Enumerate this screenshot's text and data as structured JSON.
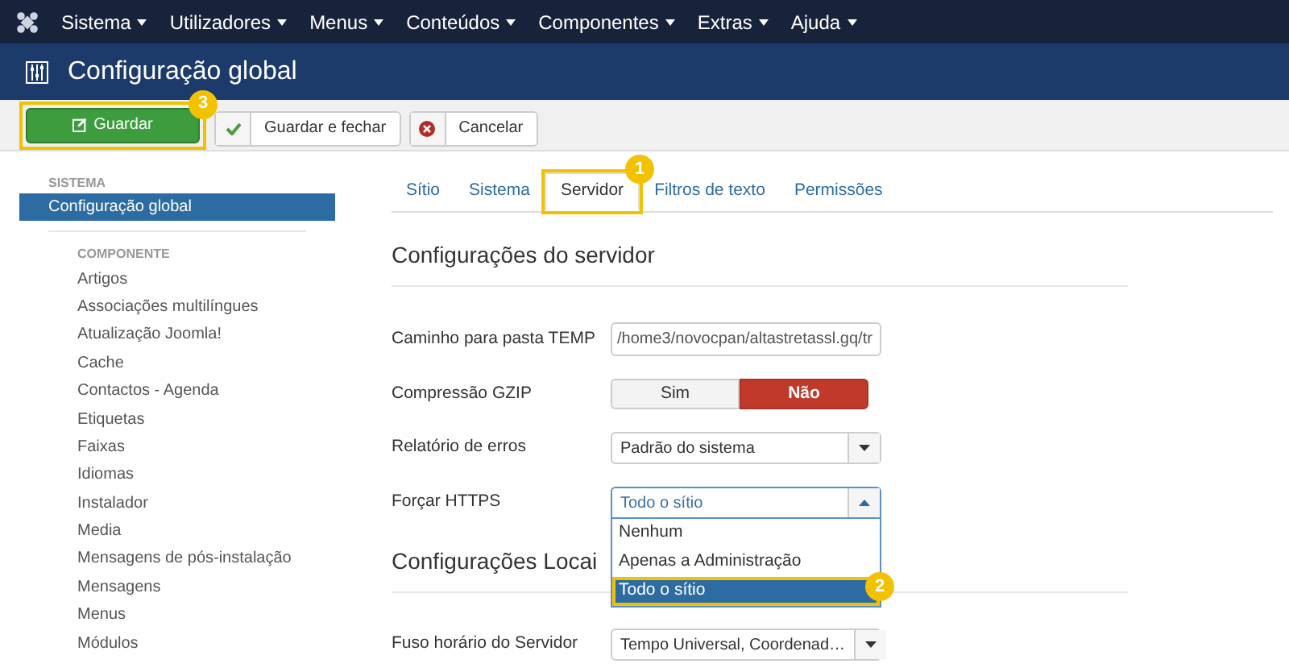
{
  "menu": [
    "Sistema",
    "Utilizadores",
    "Menus",
    "Conteúdos",
    "Componentes",
    "Extras",
    "Ajuda"
  ],
  "header": {
    "title": "Configuração global"
  },
  "toolbar": [
    {
      "kind": "save",
      "label": "Guardar",
      "callout": "3"
    },
    {
      "kind": "check",
      "label": "Guardar e fechar"
    },
    {
      "kind": "cancel",
      "label": "Cancelar"
    }
  ],
  "sidebar": {
    "sections": [
      {
        "heading": "SISTEMA",
        "items": [
          {
            "label": "Configuração global",
            "selected": true
          }
        ]
      },
      {
        "heading": "COMPONENTE",
        "items": [
          {
            "label": "Artigos",
            "selected": false
          },
          {
            "label": "Associações multilíngues",
            "selected": false
          },
          {
            "label": "Atualização Joomla!",
            "selected": false
          },
          {
            "label": "Cache",
            "selected": false
          },
          {
            "label": "Contactos - Agenda",
            "selected": false
          },
          {
            "label": "Etiquetas",
            "selected": false
          },
          {
            "label": "Faixas",
            "selected": false
          },
          {
            "label": "Idiomas",
            "selected": false
          },
          {
            "label": "Instalador",
            "selected": false
          },
          {
            "label": "Media",
            "selected": false
          },
          {
            "label": "Mensagens de pós-instalação",
            "selected": false
          },
          {
            "label": "Mensagens",
            "selected": false
          },
          {
            "label": "Menus",
            "selected": false
          },
          {
            "label": "Módulos",
            "selected": false
          }
        ]
      }
    ]
  },
  "tabs": [
    {
      "label": "Sítio",
      "selected": false
    },
    {
      "label": "Sistema",
      "selected": false
    },
    {
      "label": "Servidor",
      "selected": true,
      "callout": "1"
    },
    {
      "label": "Filtros de texto",
      "selected": false
    },
    {
      "label": "Permissões",
      "selected": false
    }
  ],
  "sections": [
    {
      "heading": "Configurações do servidor",
      "fields": [
        {
          "kind": "text",
          "label": "Caminho para pasta TEMP",
          "value": "/home3/novocpan/altastretassl.gq/tr"
        },
        {
          "kind": "toggle",
          "label": "Compressão GZIP",
          "options": [
            {
              "label": "Sim",
              "selected": false
            },
            {
              "label": "Não",
              "selected": true
            }
          ]
        },
        {
          "kind": "select",
          "label": "Relatório de erros",
          "value": "Padrão do sistema",
          "open": false
        },
        {
          "kind": "select",
          "label": "Forçar HTTPS",
          "value": "Todo o sítio",
          "open": true,
          "options": [
            {
              "label": "Nenhum",
              "selected": false
            },
            {
              "label": "Apenas a Administração",
              "selected": false
            },
            {
              "label": "Todo o sítio",
              "selected": true,
              "callout": "2"
            }
          ]
        }
      ]
    },
    {
      "heading": "Configurações Locai",
      "fields": [
        {
          "kind": "select",
          "label": "Fuso horário do Servidor",
          "value": "Tempo Universal, Coordenad…",
          "open": false
        }
      ]
    }
  ]
}
